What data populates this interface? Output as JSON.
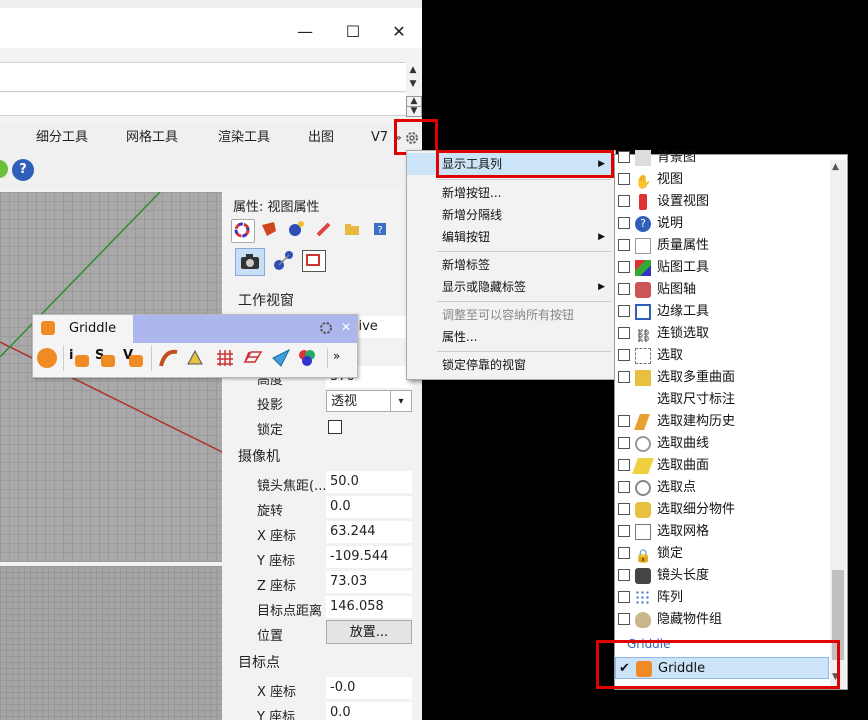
{
  "window": {
    "minimize_glyph": "—",
    "maximize_glyph": "☐",
    "close_glyph": "✕"
  },
  "tabs": [
    "细分工具",
    "网格工具",
    "渲染工具",
    "出图",
    "V7"
  ],
  "tabs_overflow": "»",
  "properties": {
    "title": "属性: 视图属性",
    "section_viewport": "工作视窗",
    "viewport_title_partial": "pective",
    "height_label": "高度",
    "height_value": "370",
    "projection_label": "投影",
    "projection_value": "透视",
    "lock_label": "锁定",
    "section_camera": "摄像机",
    "camera": [
      {
        "label": "镜头焦距(...",
        "value": "50.0"
      },
      {
        "label": "旋转",
        "value": "0.0"
      },
      {
        "label": "X 座标",
        "value": "63.244"
      },
      {
        "label": "Y 座标",
        "value": "-109.544"
      },
      {
        "label": "Z 座标",
        "value": "73.03"
      },
      {
        "label": "目标点距离",
        "value": "146.058"
      },
      {
        "label": "位置",
        "value": "放置..."
      }
    ],
    "section_target": "目标点",
    "target": [
      {
        "label": "X 座标",
        "value": "-0.0"
      },
      {
        "label": "Y 座标",
        "value": "0.0"
      }
    ]
  },
  "griddle_toolbar": {
    "title": "Griddle",
    "more": "»",
    "letters": [
      "i",
      "S",
      "V"
    ]
  },
  "context_menu": {
    "items": [
      {
        "label": "显示工具列",
        "submenu": true,
        "highlighted": true
      },
      {
        "label": "新增按钮...",
        "submenu": false
      },
      {
        "label": "新增分隔线",
        "submenu": false
      },
      {
        "label": "编辑按钮",
        "submenu": true
      },
      {
        "label": "新增标签",
        "submenu": false
      },
      {
        "label": "显示或隐藏标签",
        "submenu": true
      },
      {
        "label": "调整至可以容纳所有按钮",
        "submenu": false,
        "disabled": true
      },
      {
        "label": "属性...",
        "submenu": false
      },
      {
        "label": "锁定停靠的视窗",
        "submenu": false
      }
    ],
    "submenu_arrow": "▶"
  },
  "toolbar_list": {
    "items": [
      {
        "label": "背景图",
        "icon": "background-icon"
      },
      {
        "label": "视图",
        "icon": "hand-icon"
      },
      {
        "label": "设置视图",
        "icon": "set-view-icon"
      },
      {
        "label": "说明",
        "icon": "help-icon"
      },
      {
        "label": "质量属性",
        "icon": "mass-icon"
      },
      {
        "label": "贴图工具",
        "icon": "mapping-icon"
      },
      {
        "label": "贴图轴",
        "icon": "axis-icon"
      },
      {
        "label": "边缘工具",
        "icon": "edge-icon"
      },
      {
        "label": "连锁选取",
        "icon": "chain-icon"
      },
      {
        "label": "选取",
        "icon": "select-icon"
      },
      {
        "label": "选取多重曲面",
        "icon": "select-polysurface-icon"
      },
      {
        "label": "选取尺寸标注",
        "icon": "select-dimension-icon"
      },
      {
        "label": "选取建构历史",
        "icon": "select-history-icon"
      },
      {
        "label": "选取曲线",
        "icon": "select-curve-icon"
      },
      {
        "label": "选取曲面",
        "icon": "select-surface-icon"
      },
      {
        "label": "选取点",
        "icon": "select-point-icon"
      },
      {
        "label": "选取细分物件",
        "icon": "select-subd-icon"
      },
      {
        "label": "选取网格",
        "icon": "select-mesh-icon"
      },
      {
        "label": "锁定",
        "icon": "lock-icon"
      },
      {
        "label": "镜头长度",
        "icon": "lens-icon"
      },
      {
        "label": "阵列",
        "icon": "array-icon"
      },
      {
        "label": "隐藏物件组",
        "icon": "hide-group-icon"
      }
    ],
    "group_header": "Griddle",
    "checked_item": {
      "label": "Griddle",
      "checked": true,
      "check_glyph": "✔"
    }
  },
  "colors": {
    "highlight": "#cce4f7",
    "annotation_red": "#e00000",
    "griddle_title_bar": "#aeb6ee",
    "viewport_grey": "#a9a9a9"
  }
}
